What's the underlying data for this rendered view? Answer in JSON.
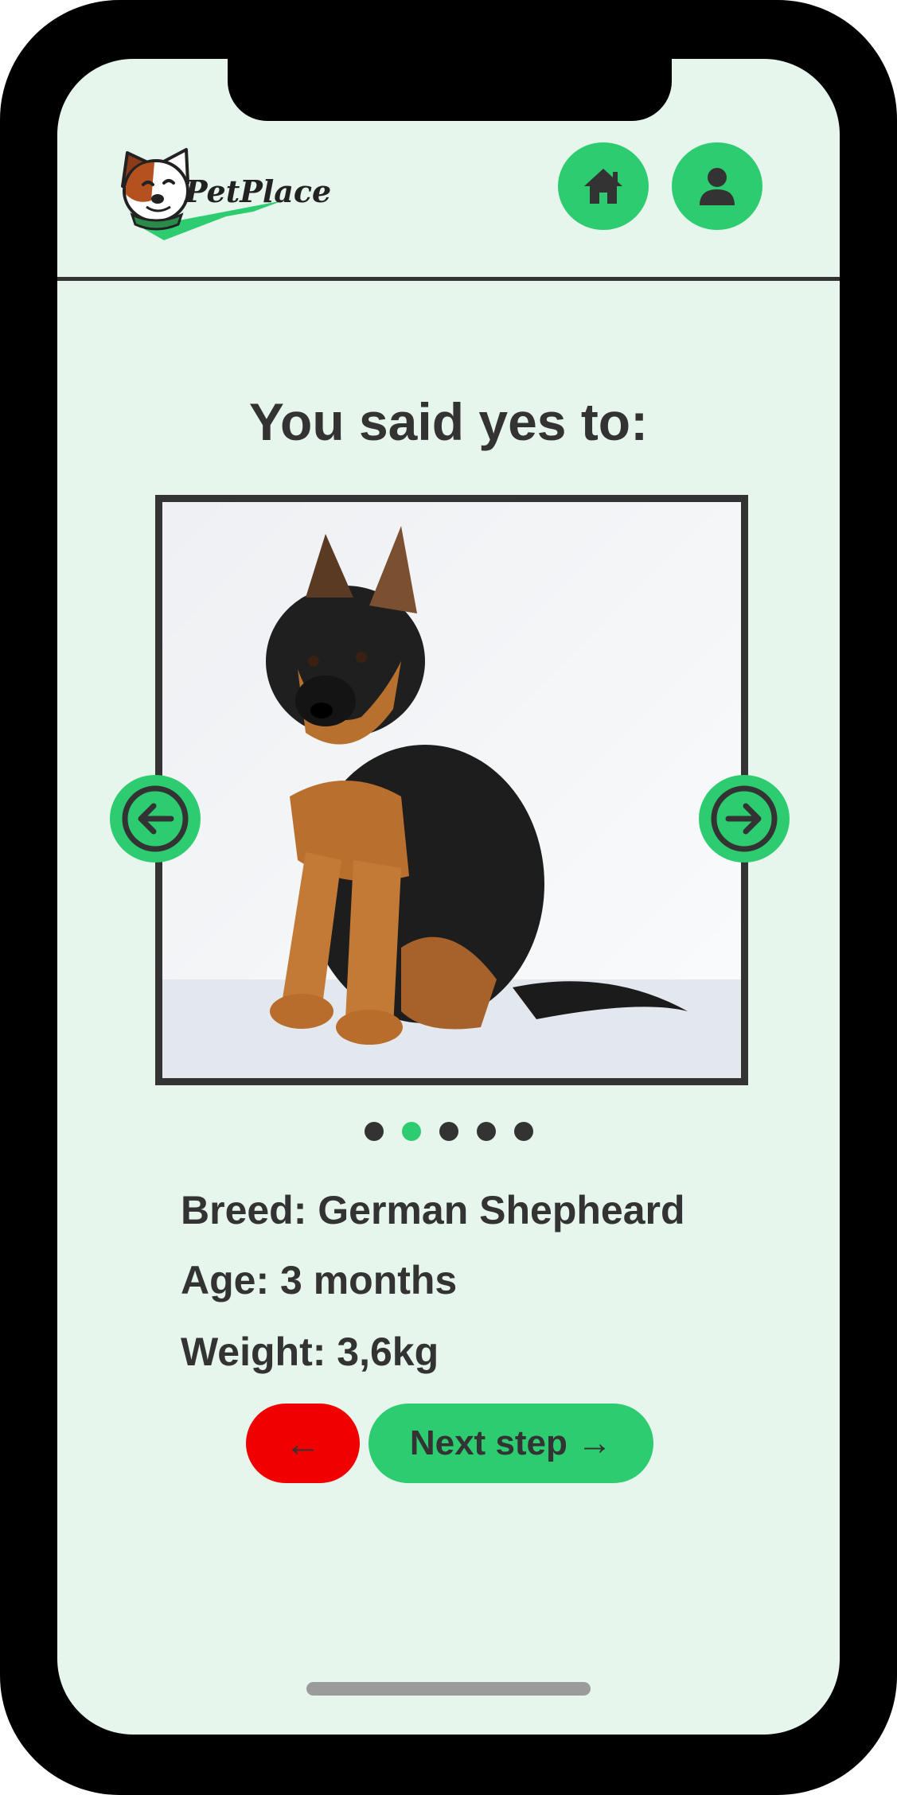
{
  "header": {
    "logo_text": "PetPlace",
    "home_icon": "home-icon",
    "profile_icon": "user-icon"
  },
  "main": {
    "heading": "You said yes to:",
    "pet_image": "German Shepherd puppy photo",
    "carousel": {
      "current_index": 2,
      "total": 5
    },
    "details": {
      "breed": "Breed: German Shepheard",
      "age": "Age: 3 months",
      "weight": "Weight: 3,6kg"
    },
    "actions": {
      "back_label": "←",
      "next_label": "Next step →"
    }
  },
  "colors": {
    "accent": "#2ecc71",
    "background": "#e7f6ec",
    "danger": "#f00000",
    "text": "#333333"
  }
}
